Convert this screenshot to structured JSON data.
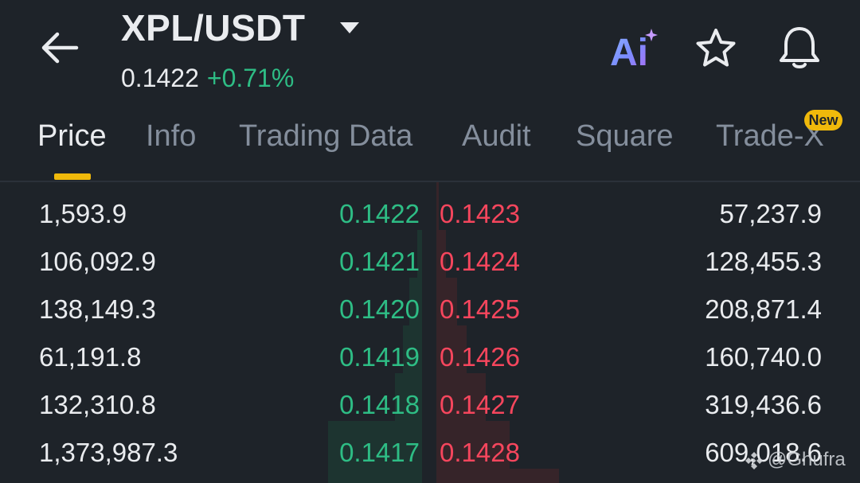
{
  "header": {
    "pair": "XPL/USDT",
    "price": "0.1422",
    "change": "+0.71%",
    "ai_label": "Ai",
    "icons": [
      "back-arrow-icon",
      "caret-down-icon",
      "ai-icon",
      "star-icon",
      "bell-icon"
    ]
  },
  "tabs": [
    {
      "label": "Price",
      "active": true
    },
    {
      "label": "Info",
      "active": false
    },
    {
      "label": "Trading Data",
      "active": false
    },
    {
      "label": "Audit",
      "active": false
    },
    {
      "label": "Square",
      "active": false
    },
    {
      "label": "Trade-X",
      "active": false,
      "badge": "New"
    }
  ],
  "order_book": {
    "rows": [
      {
        "bid_qty": "1,593.9",
        "bid_price": "0.1422",
        "ask_price": "0.1423",
        "ask_qty": "57,237.9"
      },
      {
        "bid_qty": "106,092.9",
        "bid_price": "0.1421",
        "ask_price": "0.1424",
        "ask_qty": "128,455.3"
      },
      {
        "bid_qty": "138,149.3",
        "bid_price": "0.1420",
        "ask_price": "0.1425",
        "ask_qty": "208,871.4"
      },
      {
        "bid_qty": "61,191.8",
        "bid_price": "0.1419",
        "ask_price": "0.1426",
        "ask_qty": "160,740.0"
      },
      {
        "bid_qty": "132,310.8",
        "bid_price": "0.1418",
        "ask_price": "0.1427",
        "ask_qty": "319,436.6"
      },
      {
        "bid_qty": "1,373,987.3",
        "bid_price": "0.1417",
        "ask_price": "0.1428",
        "ask_qty": "609,018.6"
      }
    ]
  },
  "watermark": "@Ghufra",
  "colors": {
    "background": "#1e2329",
    "bid": "#2ebd85",
    "ask": "#f6465d",
    "accent": "#f0b90b",
    "muted": "#848e9c"
  }
}
